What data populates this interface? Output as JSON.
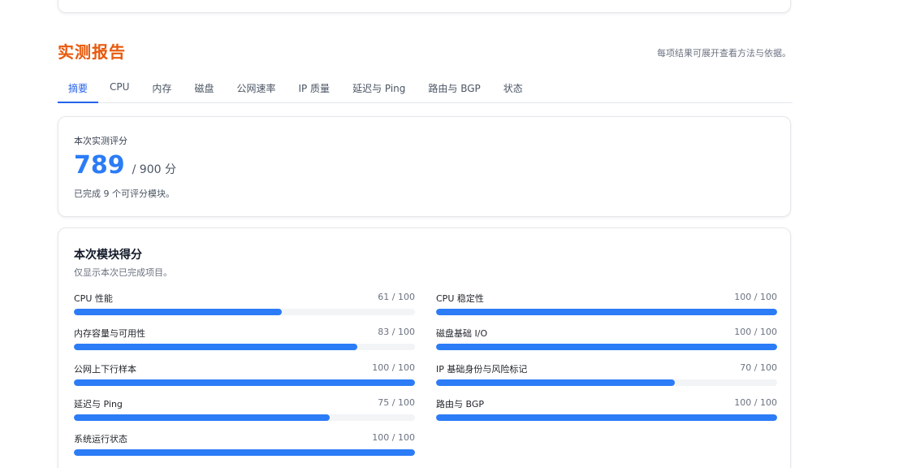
{
  "section": {
    "title": "实测报告",
    "note": "每项结果可展开查看方法与依据。"
  },
  "tabs": [
    {
      "label": "摘要",
      "active": true
    },
    {
      "label": "CPU",
      "active": false
    },
    {
      "label": "内存",
      "active": false
    },
    {
      "label": "磁盘",
      "active": false
    },
    {
      "label": "公网速率",
      "active": false
    },
    {
      "label": "IP 质量",
      "active": false
    },
    {
      "label": "延迟与 Ping",
      "active": false
    },
    {
      "label": "路由与 BGP",
      "active": false
    },
    {
      "label": "状态",
      "active": false
    }
  ],
  "score": {
    "label": "本次实测评分",
    "value": "789",
    "max": "/ 900 分",
    "note": "已完成 9 个可评分模块。"
  },
  "modules": {
    "title": "本次模块得分",
    "subtitle": "仅显示本次已完成项目。",
    "items": [
      {
        "name": "CPU 性能",
        "score_text": "61 / 100",
        "score": 61
      },
      {
        "name": "CPU 稳定性",
        "score_text": "100 / 100",
        "score": 100
      },
      {
        "name": "内存容量与可用性",
        "score_text": "83 / 100",
        "score": 83
      },
      {
        "name": "磁盘基础 I/O",
        "score_text": "100 / 100",
        "score": 100
      },
      {
        "name": "公网上下行样本",
        "score_text": "100 / 100",
        "score": 100
      },
      {
        "name": "IP 基础身份与风险标记",
        "score_text": "70 / 100",
        "score": 70
      },
      {
        "name": "延迟与 Ping",
        "score_text": "75 / 100",
        "score": 75
      },
      {
        "name": "路由与 BGP",
        "score_text": "100 / 100",
        "score": 100
      },
      {
        "name": "系统运行状态",
        "score_text": "100 / 100",
        "score": 100
      }
    ]
  },
  "colors": {
    "accent": "#2b7cf6",
    "title": "#e8590c",
    "track": "#f3f4f6"
  }
}
